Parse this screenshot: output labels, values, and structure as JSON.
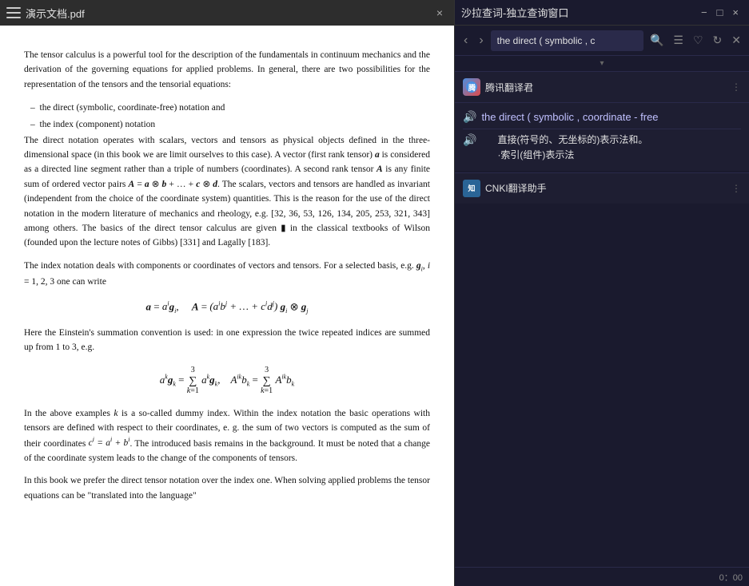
{
  "pdf": {
    "title": "演示文档.pdf",
    "close_btn": "×",
    "paragraphs": [
      "The tensor calculus is a powerful tool for the description of the fundamentals in continuum mechanics and the derivation of the governing equations for applied problems. In general, there are two possibilities for the representation of the tensors and the tensorial equations:",
      "the direct (symbolic, coordinate-free) notation and",
      "the index (component) notation",
      "The direct notation operates with scalars, vectors and tensors as physical objects defined in the three-dimensional space (in this book we are limit ourselves to this case). A vector (first rank tensor) a is considered as a directed line segment rather than a triple of numbers (coordinates). A second rank tensor A is any finite sum of ordered vector pairs A = a⊗b + … + c⊗d. The scalars, vectors and tensors are handled as invariant (independent from the choice of the coordinate system) quantities. This is the reason for the use of the direct notation in the modern literature of mechanics and rheology, e.g. [32, 36, 53, 126, 134, 205, 253, 321, 343] among others. The basics of the direct tensor calculus are given in the classical textbooks of Wilson (founded upon the lecture notes of Gibbs) [331] and Lagally [183].",
      "The index notation deals with components or coordinates of vectors and tensors. For a selected basis, e.g. gᵢ, i = 1, 2, 3 one can write",
      "Here the Einstein's summation convention is used: in one expression the twice repeated indices are summed up from 1 to 3, e.g.",
      "In the above examples k is a so-called dummy index. Within the index notation the basic operations with tensors are defined with respect to their coordinates, e.g. the sum of two vectors is computed as the sum of their coordinates cⁱ = aⁱ + bⁱ. The introduced basis remains in the background. It must be noted that a change of the coordinate system leads to the change of the components of tensors.",
      "In this book we prefer the direct tensor notation over the index one. When solving applied problems the tensor equations can be \"translated into the language\""
    ]
  },
  "dict": {
    "title": "沙拉查词-独立查询窗口",
    "nav": {
      "back_label": "‹",
      "forward_label": "›",
      "search_value": "the direct ( symbolic , c",
      "search_placeholder": "the direct ( symbolic , c"
    },
    "win_btns": {
      "minimize": "−",
      "maximize": "□",
      "close": "×"
    },
    "tencent": {
      "logo_text": "腾",
      "name": "腾讯翻译君",
      "expand_icon": "⋮",
      "translation_en": "the direct ( symbolic , coordinate - free",
      "speaker1": "🔊",
      "speaker2": "🔊",
      "translation_zh_line1": "直接(符号的、无坐标的)表示法和。",
      "translation_zh_line2": "·索引(组件)表示法"
    },
    "cnki": {
      "logo_text": "知",
      "name": "CNKI翻译助手",
      "expand_icon": "⋮"
    },
    "statusbar": {
      "time": "0：00"
    }
  }
}
